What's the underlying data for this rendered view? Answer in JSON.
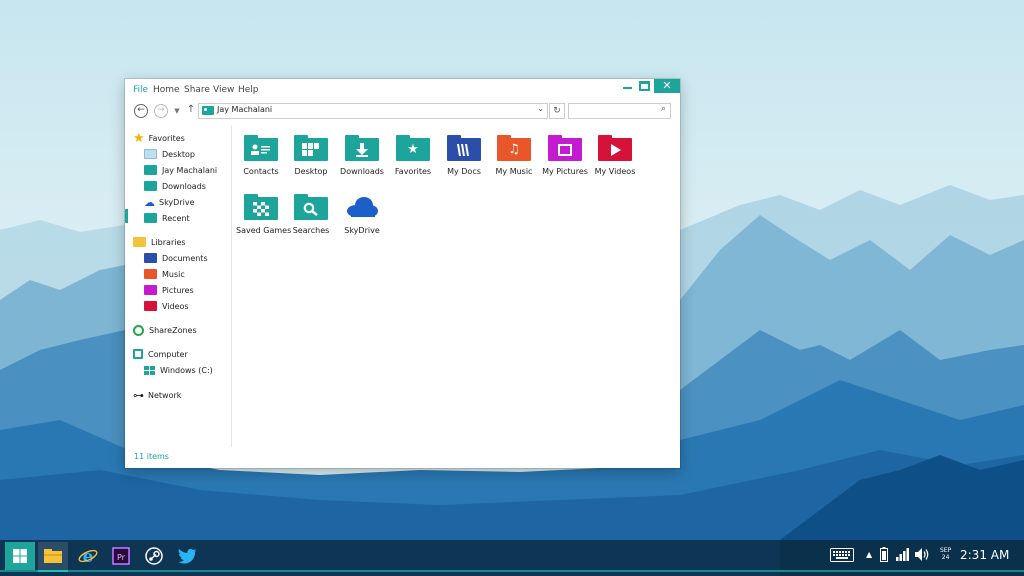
{
  "window": {
    "menus": [
      "File",
      "Home",
      "Share",
      "View",
      "Help"
    ],
    "close_glyph": "✕"
  },
  "address": {
    "path": "Jay Machalani",
    "search_placeholder": ""
  },
  "nav": {
    "favorites": "Favorites",
    "desktop": "Desktop",
    "jay": "Jay Machalani",
    "downloads": "Downloads",
    "skydrive": "SkyDrive",
    "recent": "Recent",
    "libraries": "Libraries",
    "documents": "Documents",
    "music": "Music",
    "pictures": "Pictures",
    "videos": "Videos",
    "sharezones": "ShareZones",
    "computer": "Computer",
    "windows_c": "Windows (C:)",
    "network": "Network"
  },
  "folders": [
    {
      "label": "Contacts",
      "color": "#1da59c",
      "icon": "contact-card-icon"
    },
    {
      "label": "Desktop",
      "color": "#1da59c",
      "icon": "tiles-grid-icon"
    },
    {
      "label": "Downloads",
      "color": "#1da59c",
      "icon": "download-arrow-icon"
    },
    {
      "label": "Favorites",
      "color": "#1da59c",
      "icon": "star-icon"
    },
    {
      "label": "My Docs",
      "color": "#2b4fa8",
      "icon": "document-lines-icon"
    },
    {
      "label": "My Music",
      "color": "#e8562a",
      "icon": "music-note-icon"
    },
    {
      "label": "My Pictures",
      "color": "#c21bd0",
      "icon": "picture-frame-icon"
    },
    {
      "label": "My Videos",
      "color": "#d4123a",
      "icon": "play-icon"
    },
    {
      "label": "Saved Games",
      "color": "#1da59c",
      "icon": "checkerboard-icon"
    },
    {
      "label": "Searches",
      "color": "#1da59c",
      "icon": "magnifier-icon"
    },
    {
      "label": "SkyDrive",
      "color": "#1c5fc9",
      "icon": "cloud-icon"
    }
  ],
  "status": {
    "items": "11 items"
  },
  "taskbar": {
    "clock_month": "SEP",
    "clock_day": "24",
    "clock_time": "2:31 AM"
  },
  "colors": {
    "accent": "#1da59c"
  }
}
